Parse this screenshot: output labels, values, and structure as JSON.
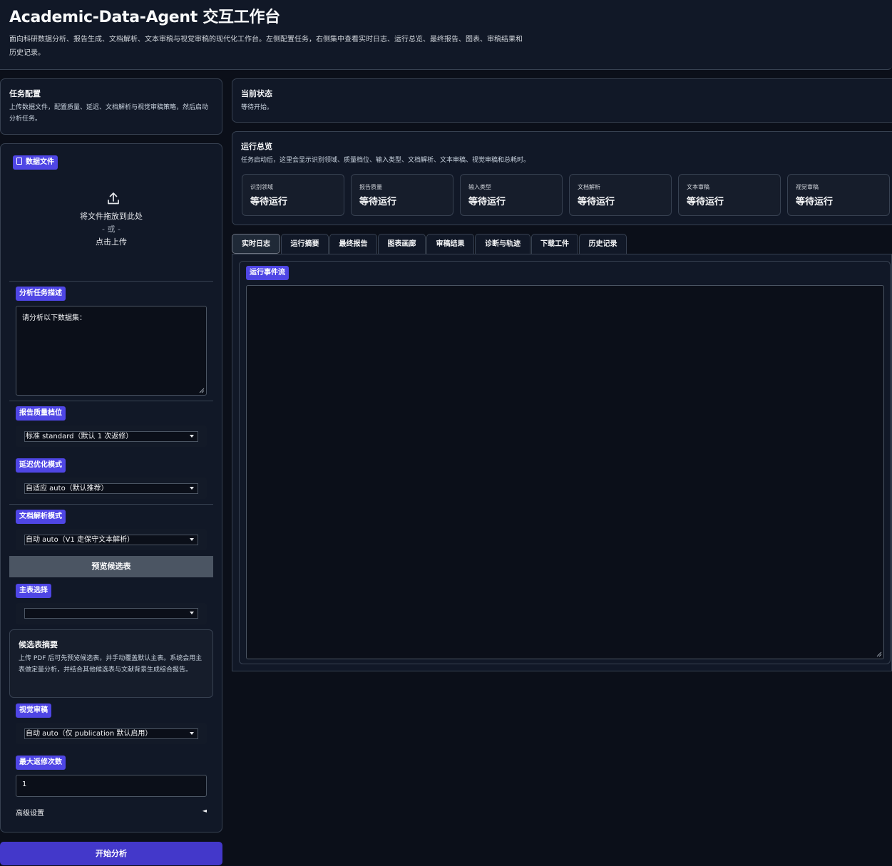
{
  "header": {
    "title": "Academic-Data-Agent 交互工作台",
    "description": "面向科研数据分析、报告生成、文档解析、文本审稿与视觉审稿的现代化工作台。左侧配置任务，右侧集中查看实时日志、运行总览、最终报告、图表、审稿结果和历史记录。"
  },
  "config": {
    "title": "任务配置",
    "desc": "上传数据文件，配置质量、延迟、文档解析与视觉审稿策略，然后启动分析任务。"
  },
  "upload": {
    "badge": "数据文件",
    "drop_text": "将文件拖放到此处",
    "or_text": "- 或 -",
    "click_text": "点击上传"
  },
  "task_desc": {
    "label": "分析任务描述",
    "value": "请分析以下数据集："
  },
  "quality": {
    "label": "报告质量档位",
    "value": "标准 standard（默认 1 次返修）"
  },
  "latency": {
    "label": "延迟优化模式",
    "value": "自适应 auto（默认推荐）"
  },
  "doc_parse": {
    "label": "文档解析模式",
    "value": "自动 auto（V1 走保守文本解析）"
  },
  "preview_btn": "预览候选表",
  "main_table": {
    "label": "主表选择",
    "value": ""
  },
  "candidate_summary": {
    "title": "候选表摘要",
    "desc": "上传 PDF 后可先预览候选表，并手动覆盖默认主表。系统会用主表做定量分析，并结合其他候选表与文献背景生成综合报告。"
  },
  "visual_review": {
    "label": "视觉审稿",
    "value": "自动 auto（仅 publication 默认启用）"
  },
  "max_revisions": {
    "label": "最大返修次数",
    "value": "1"
  },
  "advanced": {
    "label": "高级设置",
    "arrow": "◄"
  },
  "start_btn": "开始分析",
  "status": {
    "title": "当前状态",
    "text": "等待开始。"
  },
  "overview": {
    "title": "运行总览",
    "desc": "任务启动后，这里会显示识别领域、质量档位、输入类型、文档解析、文本审稿、视觉审稿和总耗时。",
    "cards": [
      {
        "label": "识别领域",
        "value": "等待运行"
      },
      {
        "label": "报告质量",
        "value": "等待运行"
      },
      {
        "label": "输入类型",
        "value": "等待运行"
      },
      {
        "label": "文档解析",
        "value": "等待运行"
      },
      {
        "label": "文本审稿",
        "value": "等待运行"
      },
      {
        "label": "视觉审稿",
        "value": "等待运行"
      }
    ]
  },
  "tabs": [
    "实时日志",
    "运行摘要",
    "最终报告",
    "图表画廊",
    "审稿结果",
    "诊断与轨迹",
    "下载工件",
    "历史记录"
  ],
  "log": {
    "label": "运行事件流",
    "value": ""
  },
  "colors": {
    "accent": "#4f46e5",
    "background": "#0b0f19",
    "panel": "#111827",
    "border": "#374151"
  }
}
